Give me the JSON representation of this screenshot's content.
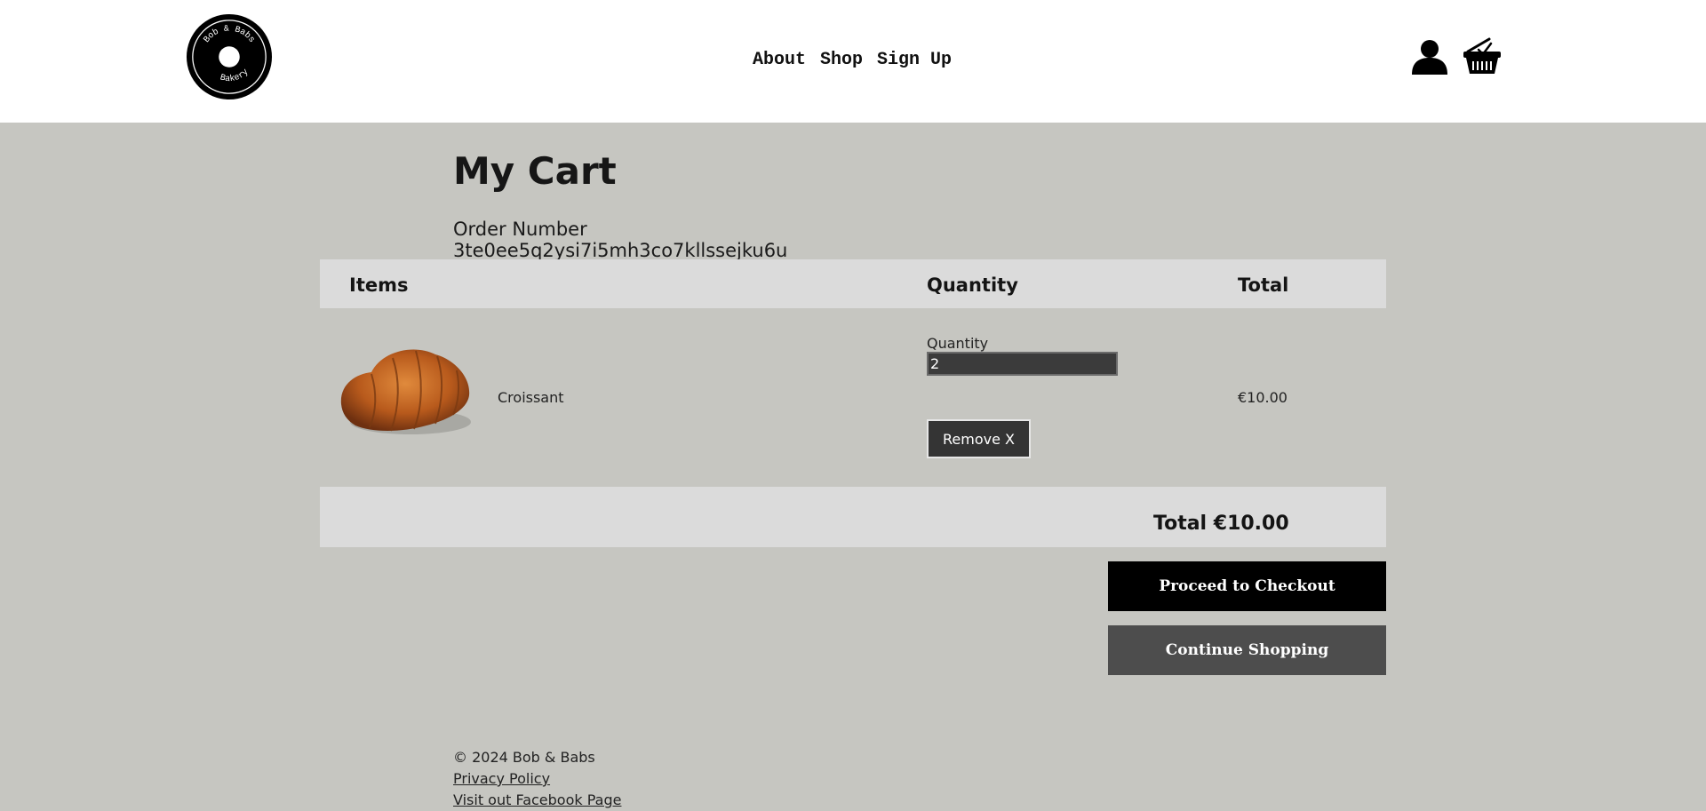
{
  "header": {
    "logo": {
      "text_top": "Bob & Babs",
      "text_bottom": "Bakery",
      "icon": "bakery-logo"
    },
    "nav": [
      {
        "label": "About"
      },
      {
        "label": "Shop"
      },
      {
        "label": "Sign Up"
      }
    ],
    "icons": {
      "account": "user-icon",
      "cart": "basket-icon"
    }
  },
  "cart": {
    "title": "My Cart",
    "order_label": "Order Number",
    "order_number": "3te0ee5q2ysi7i5mh3co7kllssejku6u",
    "columns": {
      "items": "Items",
      "quantity": "Quantity",
      "total": "Total"
    },
    "rows": [
      {
        "name": "Croissant",
        "quantity_label": "Quantity",
        "quantity": "2",
        "remove_label": "Remove X",
        "total": "€10.00",
        "image": "croissant-image"
      }
    ],
    "grand_total": "Total €10.00",
    "checkout_label": "Proceed to Checkout",
    "continue_label": "Continue Shopping"
  },
  "footer": {
    "copyright": "© 2024 Bob & Babs",
    "privacy": "Privacy Policy",
    "facebook": "Visit out Facebook Page"
  },
  "colors": {
    "page_bg": "#c6c6c1",
    "header_bg": "#ffffff",
    "table_band": "#dbdbdb",
    "checkout_bg": "#000000",
    "continue_bg": "#4d4d4d",
    "input_bg": "#3b3b3b"
  }
}
